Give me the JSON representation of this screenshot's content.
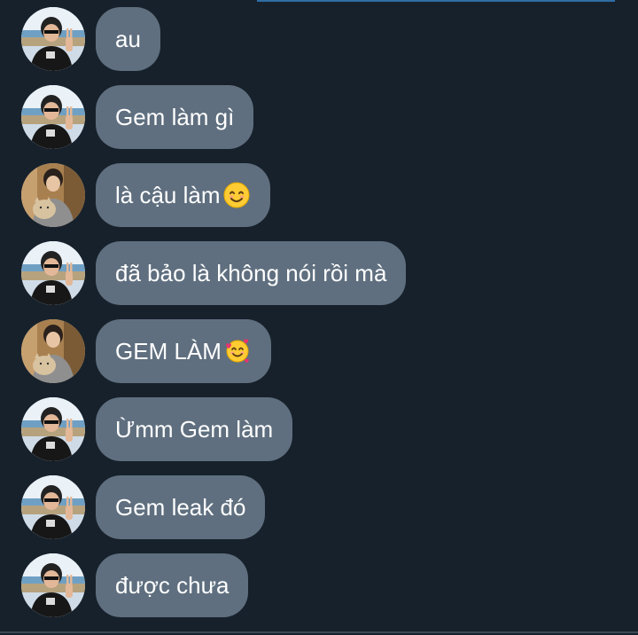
{
  "messages": [
    {
      "avatar_icon": "boy-peace-sign-avatar-icon",
      "text": "au",
      "emoji": ""
    },
    {
      "avatar_icon": "boy-peace-sign-avatar-icon",
      "text": "Gem làm gì",
      "emoji": ""
    },
    {
      "avatar_icon": "boy-with-cat-avatar-icon",
      "text": "là cậu làm",
      "emoji": "smiling-face-icon"
    },
    {
      "avatar_icon": "boy-peace-sign-avatar-icon",
      "text": "đã bảo là không nói rồi mà",
      "emoji": ""
    },
    {
      "avatar_icon": "boy-with-cat-avatar-icon",
      "text": "GEM LÀM ",
      "emoji": "smiling-face-with-hearts-icon"
    },
    {
      "avatar_icon": "boy-peace-sign-avatar-icon",
      "text": "Ừmm Gem làm",
      "emoji": ""
    },
    {
      "avatar_icon": "boy-peace-sign-avatar-icon",
      "text": "Gem leak đó",
      "emoji": ""
    },
    {
      "avatar_icon": "boy-peace-sign-avatar-icon",
      "text": "được chưa",
      "emoji": ""
    }
  ],
  "colors": {
    "background": "#17212b",
    "bubble": "#5f6f7f",
    "text": "#ffffff",
    "accent": "#2f6ea5"
  }
}
